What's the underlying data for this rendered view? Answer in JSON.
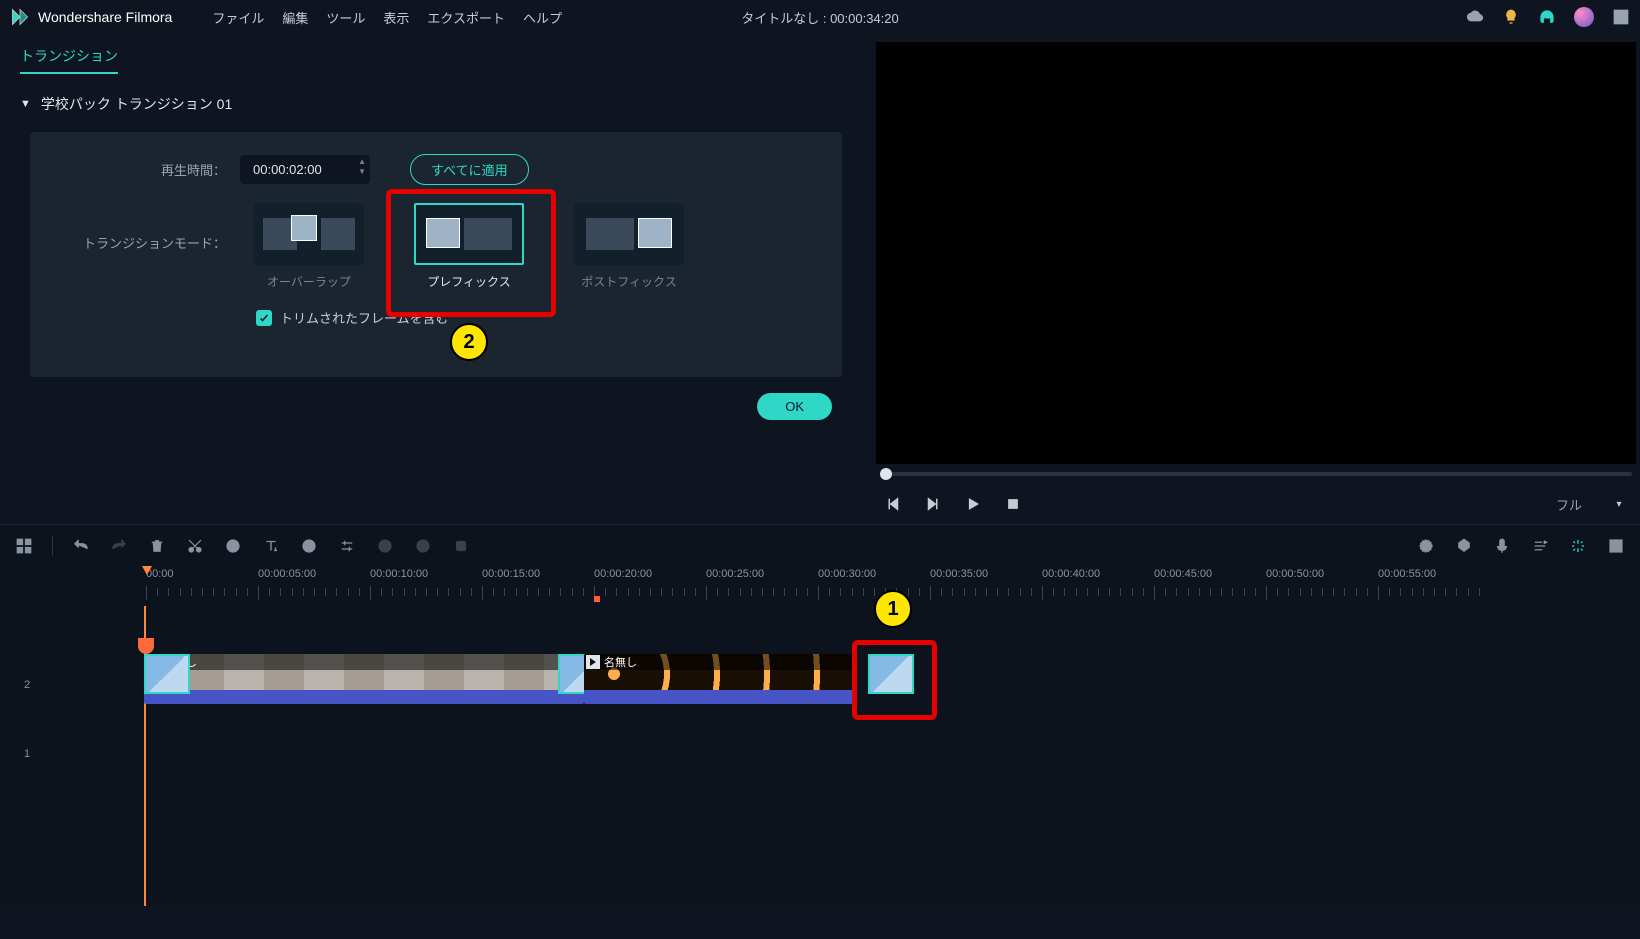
{
  "app_name": "Wondershare Filmora",
  "menus": [
    "ファイル",
    "編集",
    "ツール",
    "表示",
    "エクスポート",
    "ヘルプ"
  ],
  "project_title": "タイトルなし : 00:00:34:20",
  "tab_label": "トランジション",
  "section_title": "学校パック トランジション 01",
  "props": {
    "duration_label": "再生時間：",
    "duration_value": "00:00:02:00",
    "apply_all_label": "すべてに適用",
    "mode_label": "トランジションモード：",
    "modes": {
      "overlap": "オーバーラップ",
      "prefix": "プレフィックス",
      "postfix": "ポストフィックス"
    },
    "include_trimmed_label": "トリムされたフレームを含む"
  },
  "ok_label": "OK",
  "playback": {
    "fullscreen_label": "フル"
  },
  "ruler": {
    "labels": [
      "00:00",
      "00:00:05:00",
      "00:00:10:00",
      "00:00:15:00",
      "00:00:20:00",
      "00:00:25:00",
      "00:00:30:00",
      "00:00:35:00",
      "00:00:40:00",
      "00:00:45:00",
      "00:00:50:00",
      "00:00:55:00"
    ]
  },
  "tracks": {
    "clip1_label": "名無し",
    "clip2_label": "名無し",
    "video_track_num": "2",
    "audio_track_num": "1"
  },
  "callouts": {
    "one": "1",
    "two": "2"
  }
}
